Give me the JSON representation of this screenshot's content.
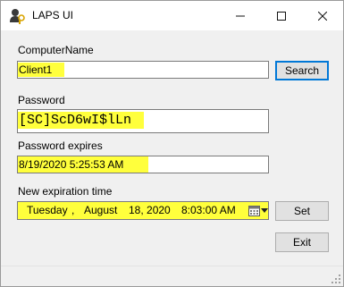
{
  "window": {
    "title": "LAPS UI",
    "icon": "laps-app-icon",
    "controls": {
      "minimize": "minimize-icon",
      "maximize": "maximize-icon",
      "close": "close-icon"
    }
  },
  "computer": {
    "label": "ComputerName",
    "value": "Client1",
    "search_label": "Search"
  },
  "password": {
    "label": "Password",
    "value": "[SC]ScD6wI$lLn"
  },
  "expires": {
    "label": "Password expires",
    "value": "8/19/2020 5:25:53 AM"
  },
  "new_expiration": {
    "label": "New expiration time",
    "weekday": "Tuesday",
    "sep": ",",
    "month": "August",
    "day": "18, 2020",
    "time": "8:03:00 AM",
    "set_label": "Set"
  },
  "exit_label": "Exit",
  "colors": {
    "highlight": "#ffff3c",
    "accent": "#0078d7"
  }
}
